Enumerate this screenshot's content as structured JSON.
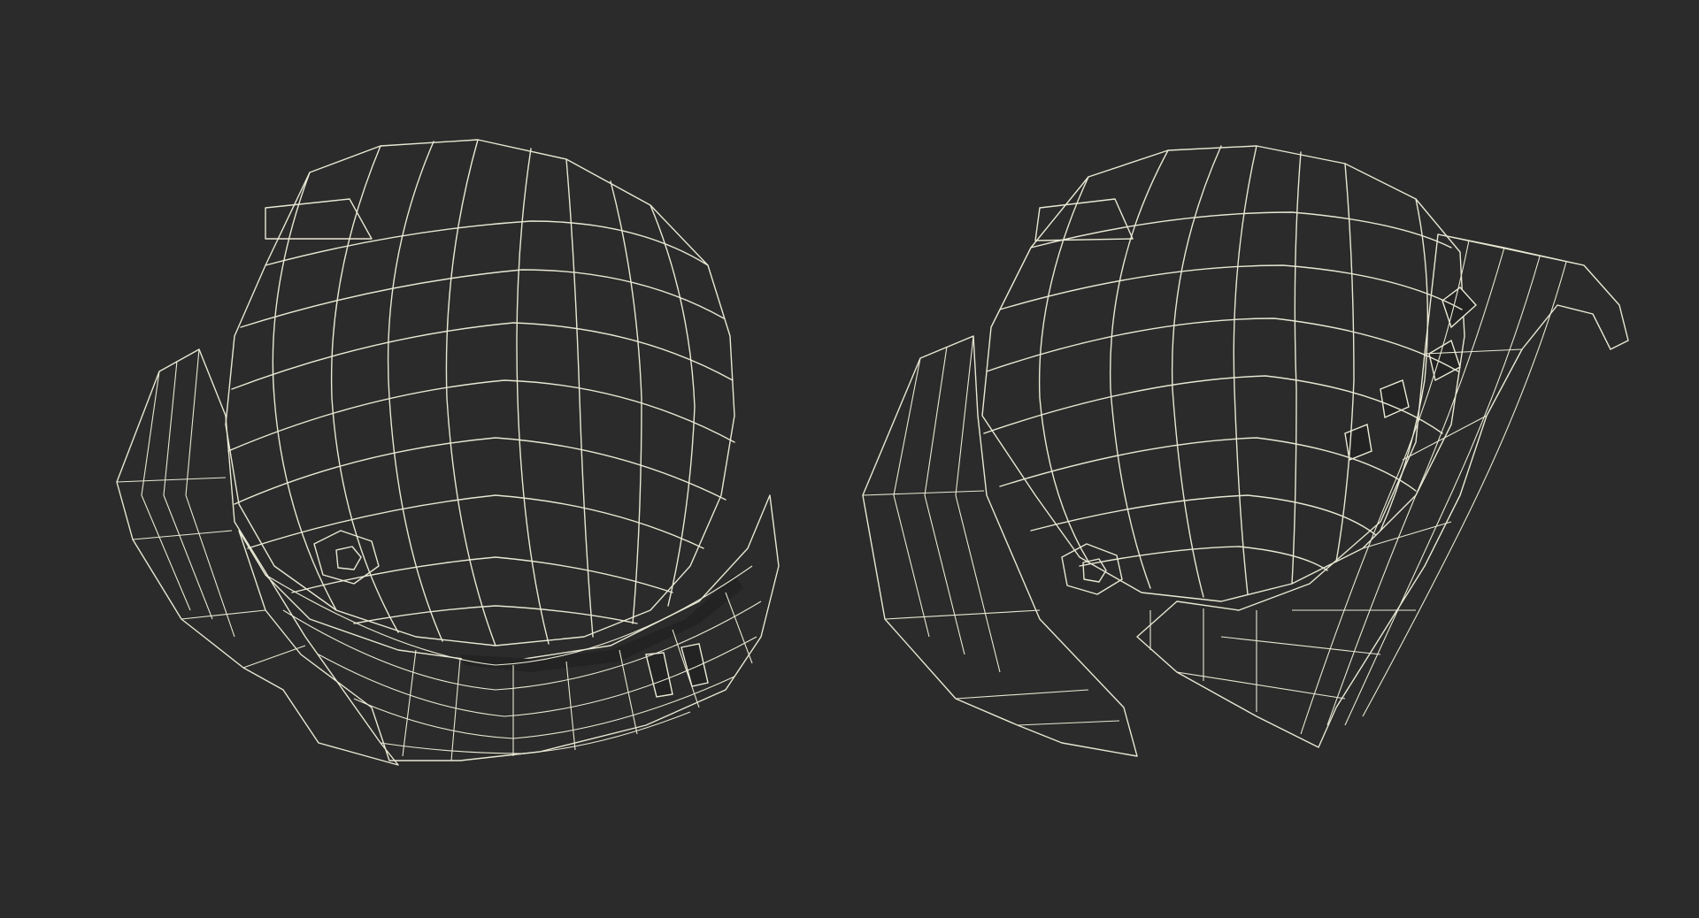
{
  "scene": {
    "subject": "helmet-wireframe-renders",
    "background_color": "#2b2b2b",
    "mesh_color": "#7b7b6e",
    "wire_color": "#e9e8d4",
    "views": [
      "helmet-front-view",
      "helmet-side-view"
    ]
  }
}
